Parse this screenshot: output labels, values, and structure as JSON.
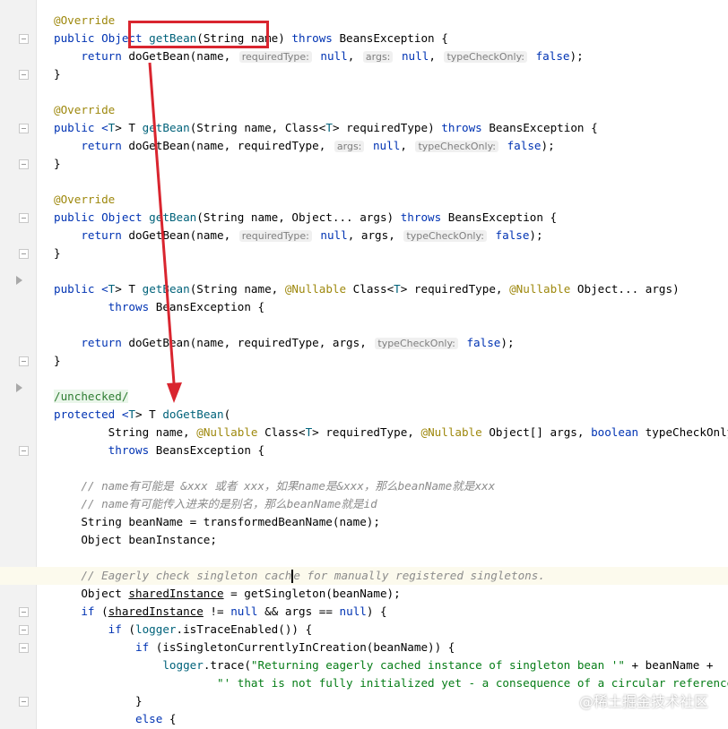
{
  "watermark": "@稀土掘金技术社区",
  "editor": {
    "l01_a": "@Override",
    "l02_a": "public Object ",
    "l02_b": "getBean",
    "l02_c": "(String name) ",
    "l02_d": "throws",
    "l02_e": " BeansException {",
    "l03_a": "    return ",
    "l03_b": "doGetBean",
    "l03_c": "(name, ",
    "l03_h1": "requiredType:",
    "l03_d": " null",
    "l03_e": ", ",
    "l03_h2": "args:",
    "l03_f": " null",
    "l03_g": ", ",
    "l03_h3": "typeCheckOnly:",
    "l03_i": " false",
    "l03_j": ");",
    "l04_a": "}",
    "l06_a": "@Override",
    "l07_a": "public <",
    "l07_b": "T",
    "l07_c": "> T ",
    "l07_d": "getBean",
    "l07_e": "(String name, Class<",
    "l07_f": "T",
    "l07_g": "> requiredType) ",
    "l07_h": "throws",
    "l07_i": " BeansException {",
    "l08_a": "    return ",
    "l08_b": "doGetBean",
    "l08_c": "(name, requiredType, ",
    "l08_h1": "args:",
    "l08_d": " null",
    "l08_e": ", ",
    "l08_h2": "typeCheckOnly:",
    "l08_f": " false",
    "l08_g": ");",
    "l09_a": "}",
    "l11_a": "@Override",
    "l12_a": "public Object ",
    "l12_b": "getBean",
    "l12_c": "(String name, Object... args) ",
    "l12_d": "throws",
    "l12_e": " BeansException {",
    "l13_a": "    return ",
    "l13_b": "doGetBean",
    "l13_c": "(name, ",
    "l13_h1": "requiredType:",
    "l13_d": " null",
    "l13_e": ", args, ",
    "l13_h2": "typeCheckOnly:",
    "l13_f": " false",
    "l13_g": ");",
    "l14_a": "}",
    "l16_a": "public <",
    "l16_b": "T",
    "l16_c": "> T ",
    "l16_d": "getBean",
    "l16_e": "(String name, ",
    "l16_f": "@Nullable",
    "l16_g": " Class<",
    "l16_h": "T",
    "l16_i": "> requiredType, ",
    "l16_j": "@Nullable",
    "l16_k": " Object... args)",
    "l17_a": "        ",
    "l17_b": "throws",
    "l17_c": " BeansException {",
    "l19_a": "    return ",
    "l19_b": "doGetBean",
    "l19_c": "(name, requiredType, args, ",
    "l19_h1": "typeCheckOnly:",
    "l19_d": " false",
    "l19_e": ");",
    "l20_a": "}",
    "l22_a": "/unchecked/",
    "l23_a": "protected <",
    "l23_b": "T",
    "l23_c": "> T ",
    "l23_d": "doGetBean",
    "l23_e": "(",
    "l24_a": "        String name, ",
    "l24_b": "@Nullable",
    "l24_c": " Class<",
    "l24_d": "T",
    "l24_e": "> requiredType, ",
    "l24_f": "@Nullable",
    "l24_g": " Object[] args, ",
    "l24_h": "boolean",
    "l24_i": " typeCheckOnly)",
    "l25_a": "        ",
    "l25_b": "throws",
    "l25_c": " BeansException {",
    "l27_a": "    // name有可能是 &xxx 或者 xxx，如果name是&xxx，那么beanName就是xxx",
    "l28_a": "    // name有可能传入进来的是别名，那么beanName就是id",
    "l29_a": "    String beanName = transformedBeanName(name);",
    "l30_a": "    Object beanInstance;",
    "l32_a": "    // Eagerly check singleton cach",
    "l32_b": "e for manually registered singletons.",
    "l33_a": "    Object ",
    "l33_b": "sharedInstance",
    "l33_c": " = getSingleton(beanName);",
    "l34_a": "    ",
    "l34_b": "if",
    "l34_c": " (",
    "l34_d": "sharedInstance",
    "l34_e": " != ",
    "l34_f": "null",
    "l34_g": " && args == ",
    "l34_h": "null",
    "l34_i": ") {",
    "l35_a": "        ",
    "l35_b": "if",
    "l35_c": " (",
    "l35_d": "logger",
    "l35_e": ".isTraceEnabled()) {",
    "l36_a": "            ",
    "l36_b": "if",
    "l36_c": " (isSingletonCurrentlyInCreation(beanName)) {",
    "l37_a": "                ",
    "l37_b": "logger",
    "l37_c": ".trace(",
    "l37_d": "\"Returning eagerly cached instance of singleton bean '\"",
    "l37_e": " + beanName +",
    "l38_a": "                        ",
    "l38_b": "\"' that is not fully initialized yet - a consequence of a circular reference\"",
    "l38_c": ");",
    "l39_a": "            }",
    "l40_a": "            ",
    "l40_b": "else",
    "l40_c": " {"
  }
}
